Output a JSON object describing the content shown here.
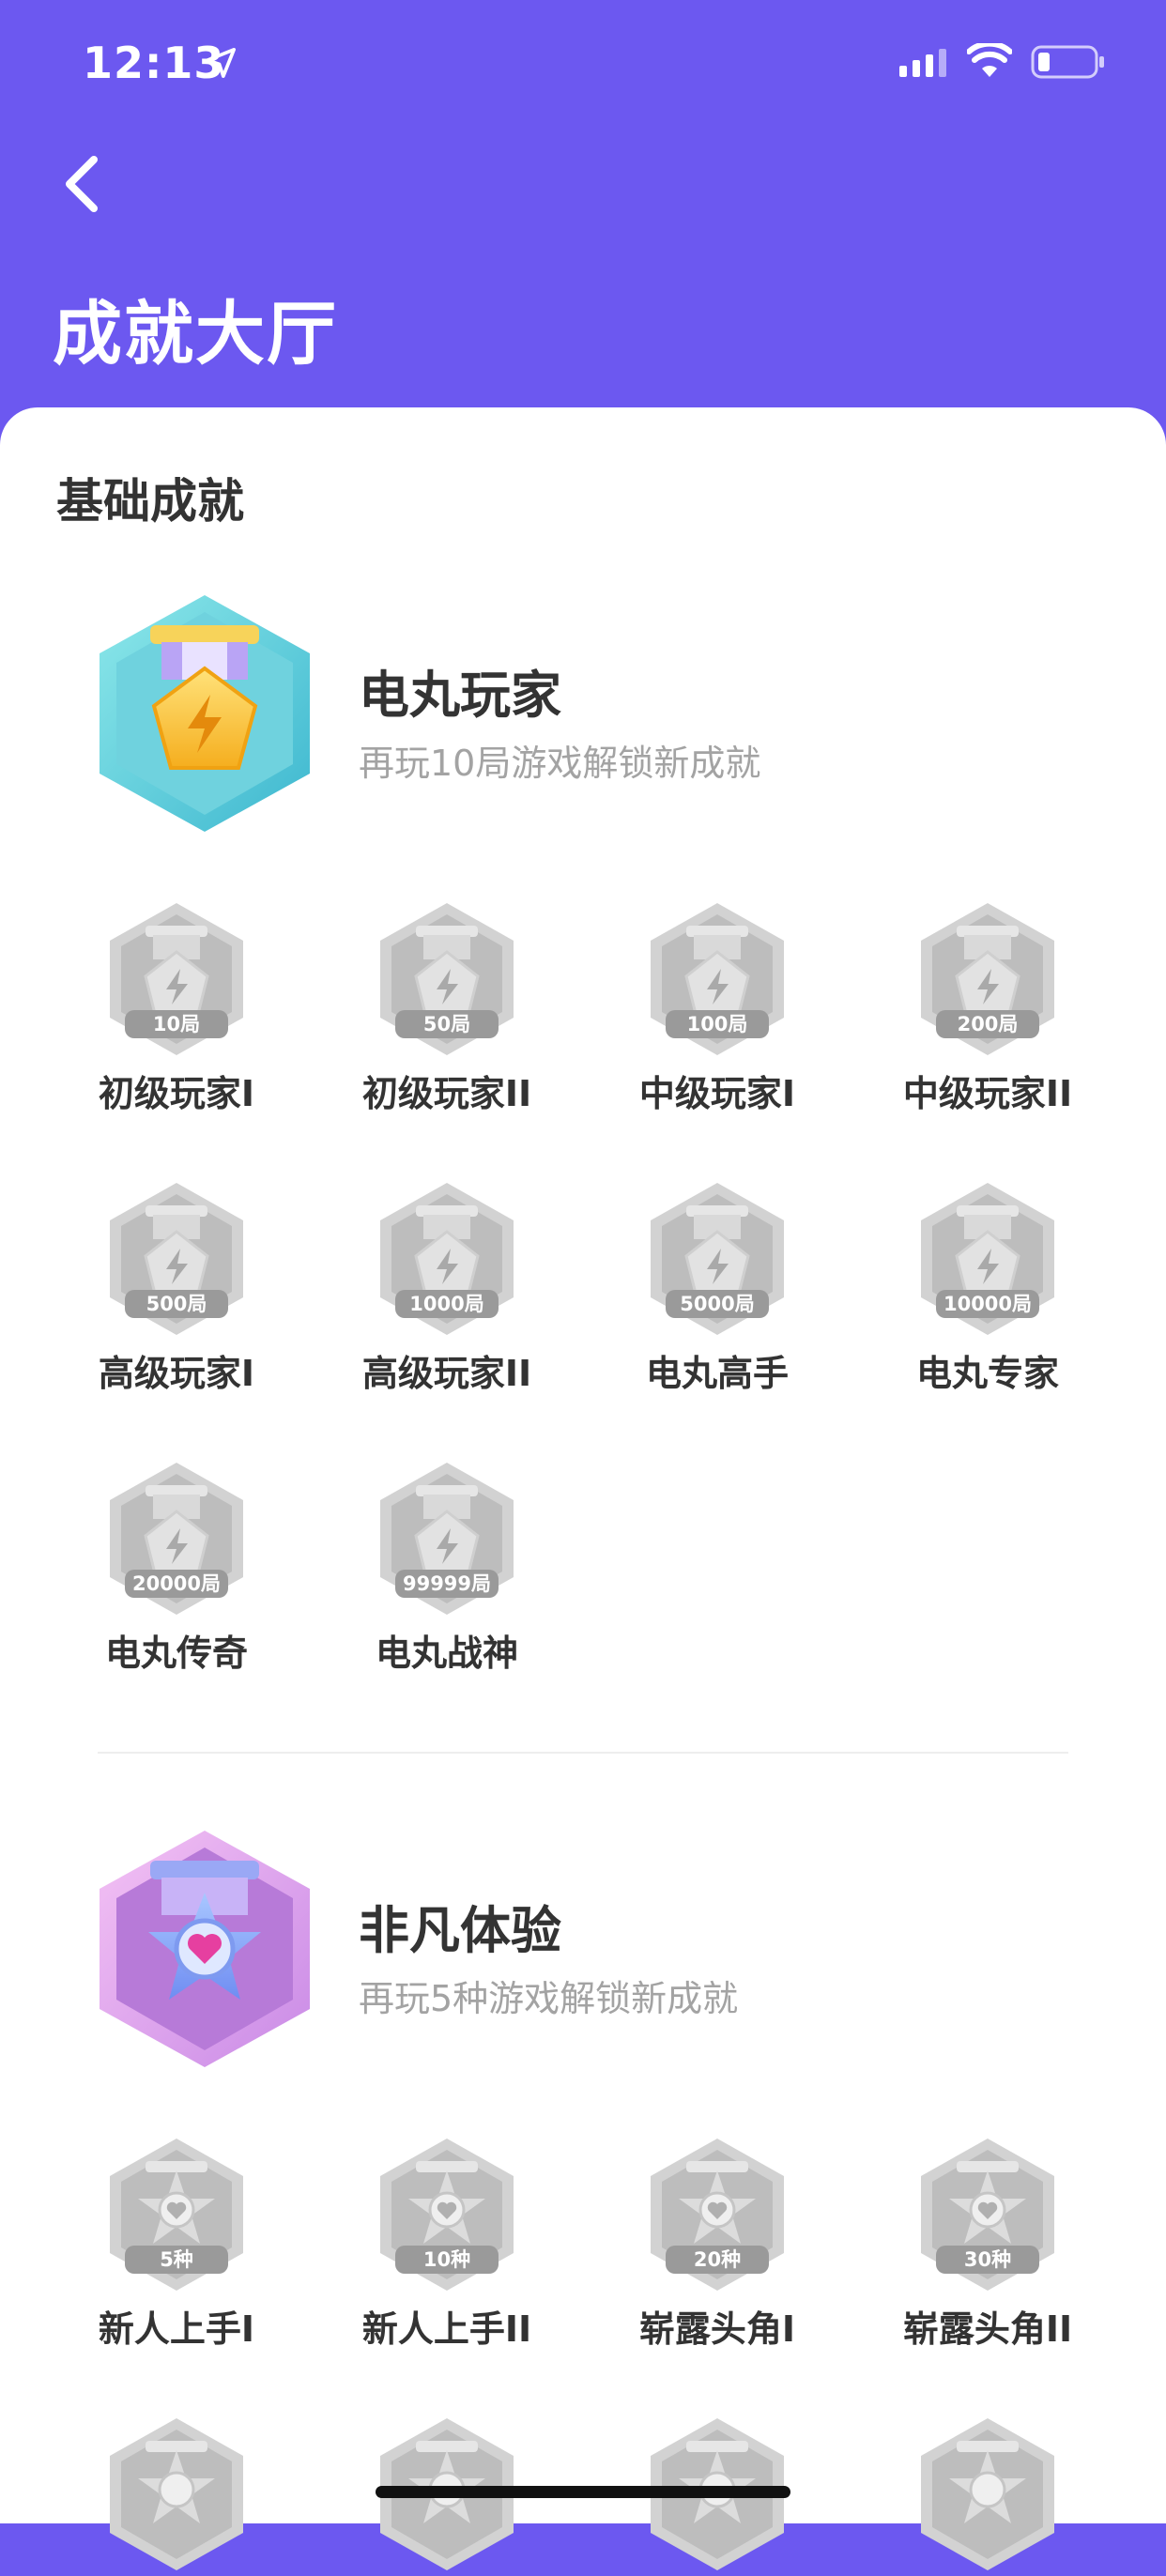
{
  "status_bar": {
    "time": "12:13"
  },
  "header": {
    "title": "成就大厅"
  },
  "section_title": "基础成就",
  "groups": [
    {
      "name": "电丸玩家",
      "subtitle": "再玩10局游戏解锁新成就",
      "badge_icon": "lightning-medal-icon",
      "items": [
        {
          "label": "初级玩家I",
          "cap": "10局"
        },
        {
          "label": "初级玩家II",
          "cap": "50局"
        },
        {
          "label": "中级玩家I",
          "cap": "100局"
        },
        {
          "label": "中级玩家II",
          "cap": "200局"
        },
        {
          "label": "高级玩家I",
          "cap": "500局"
        },
        {
          "label": "高级玩家II",
          "cap": "1000局"
        },
        {
          "label": "电丸高手",
          "cap": "5000局"
        },
        {
          "label": "电丸专家",
          "cap": "10000局"
        },
        {
          "label": "电丸传奇",
          "cap": "20000局"
        },
        {
          "label": "电丸战神",
          "cap": "99999局"
        }
      ]
    },
    {
      "name": "非凡体验",
      "subtitle": "再玩5种游戏解锁新成就",
      "badge_icon": "heart-star-medal-icon",
      "items": [
        {
          "label": "新人上手I",
          "cap": "5种"
        },
        {
          "label": "新人上手II",
          "cap": "10种"
        },
        {
          "label": "崭露头角I",
          "cap": "20种"
        },
        {
          "label": "崭露头角II",
          "cap": "30种"
        }
      ]
    }
  ],
  "colors": {
    "header_bg": "#6c58f0",
    "locked_badge": "#c8c8c8",
    "text_dark": "#333333",
    "text_muted": "#a3a3a3"
  }
}
